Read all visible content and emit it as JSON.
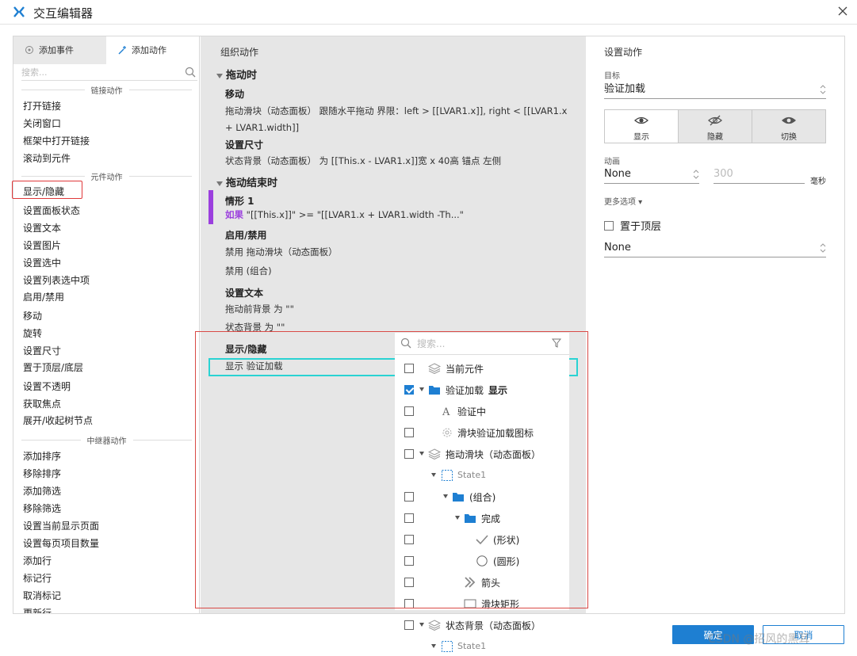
{
  "window": {
    "title": "交互编辑器"
  },
  "left": {
    "tabs": [
      "添加事件",
      "添加动作"
    ],
    "search_placeholder": "搜索...",
    "sections": {
      "link": "链接动作",
      "widget": "元件动作",
      "repeater": "中继器动作"
    },
    "link_items": [
      "打开链接",
      "关闭窗口",
      "框架中打开链接",
      "滚动到元件"
    ],
    "widget_items": [
      "显示/隐藏",
      "设置面板状态",
      "设置文本",
      "设置图片",
      "设置选中",
      "设置列表选中项",
      "启用/禁用",
      "移动",
      "旋转",
      "设置尺寸",
      "置于顶层/底层",
      "设置不透明",
      "获取焦点",
      "展开/收起树节点"
    ],
    "repeater_items": [
      "添加排序",
      "移除排序",
      "添加筛选",
      "移除筛选",
      "设置当前显示页面",
      "设置每页项目数量",
      "添加行",
      "标记行",
      "取消标记",
      "更新行"
    ]
  },
  "middle": {
    "header": "组织动作",
    "event1": "拖动时",
    "move_title": "移动",
    "move_detail": "拖动滑块（动态面板） 跟随水平拖动 界限：left > [[LVAR1.x]], right < [[LVAR1.x + LVAR1.width]]",
    "size_title": "设置尺寸",
    "size_detail": "状态背景（动态面板） 为 [[This.x - LVAR1.x]]宽 x 40高  锚点 左侧",
    "event2": "拖动结束时",
    "case_title": "情形 1",
    "case_kw": "如果",
    "case_cond": " \"[[This.x]]\" >= \"[[LVAR1.x + LVAR1.width -Th...\"",
    "enable_title": "启用/禁用",
    "enable_d1": "禁用 拖动滑块（动态面板）",
    "enable_d2": "禁用 (组合)",
    "text_title": "设置文本",
    "text_d1": "拖动前背景 为 \"\"",
    "text_d2": "状态背景 为 \"\"",
    "show_title": "显示/隐藏",
    "show_detail": "显示 验证加载"
  },
  "right": {
    "header": "设置动作",
    "target_label": "目标",
    "target_value": "验证加载",
    "seg_show": "显示",
    "seg_hide": "隐藏",
    "seg_toggle": "切换",
    "anim_label": "动画",
    "anim_value": "None",
    "duration_value": "300",
    "duration_unit": "毫秒",
    "more": "更多选项 ▾",
    "bring_front": "置于顶层",
    "more_value": "None"
  },
  "popup": {
    "search_placeholder": "搜索...",
    "rows": [
      {
        "label": "当前元件",
        "checked": false,
        "icon": "layers-icon"
      },
      {
        "label": "验证加载",
        "sub": "显示",
        "checked": true,
        "icon": "folder-icon"
      },
      {
        "label": "验证中",
        "checked": false,
        "icon": "text-icon"
      },
      {
        "label": "滑块验证加载图标",
        "checked": false,
        "icon": "spinner-icon"
      },
      {
        "label": "拖动滑块（动态面板）",
        "checked": false,
        "icon": "layers-icon"
      },
      {
        "label": "State1",
        "icon": "state-icon"
      },
      {
        "label": "(组合)",
        "checked": false,
        "icon": "folder-icon"
      },
      {
        "label": "完成",
        "checked": false,
        "icon": "folder-icon"
      },
      {
        "label": "(形状)",
        "checked": false,
        "icon": "checkmark-icon"
      },
      {
        "label": "(圆形)",
        "checked": false,
        "icon": "circle-icon"
      },
      {
        "label": "箭头",
        "checked": false,
        "icon": "double-chevron-icon"
      },
      {
        "label": "滑块矩形",
        "checked": false,
        "icon": "rectangle-icon"
      },
      {
        "label": "状态背景（动态面板）",
        "checked": false,
        "icon": "layers-icon"
      },
      {
        "label": "State1",
        "icon": "state-icon"
      }
    ]
  },
  "buttons": {
    "ok": "确定",
    "cancel": "取消"
  },
  "watermark": "CSDN @招风的黑耳",
  "colors": {
    "accent": "#1e7fd2",
    "highlight_red": "#e0383a",
    "case_bar": "#9b3fde",
    "selection": "#2ad3d3"
  }
}
